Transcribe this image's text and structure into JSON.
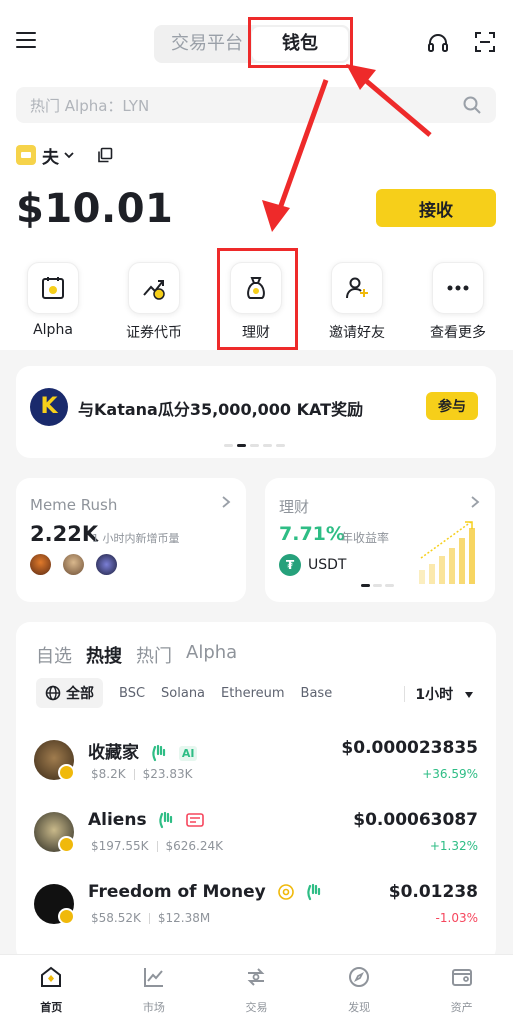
{
  "header": {
    "tabs": [
      "交易平台",
      "钱包"
    ],
    "active_tab": "钱包"
  },
  "search": {
    "placeholder": "热门 Alpha：LYN"
  },
  "account": {
    "name": "夫"
  },
  "balance": {
    "amount": "$10.01"
  },
  "receive_label": "接收",
  "quick_actions": [
    {
      "label": "Alpha",
      "icon": "alpha-icon"
    },
    {
      "label": "证券代币",
      "icon": "stock-token-icon"
    },
    {
      "label": "理财",
      "icon": "earn-bag-icon"
    },
    {
      "label": "邀请好友",
      "icon": "invite-friend-icon"
    },
    {
      "label": "查看更多",
      "icon": "more-icon"
    }
  ],
  "banner": {
    "logo_letter": "K",
    "text": "与Katana瓜分35,000,000 KAT奖励",
    "button": "参与"
  },
  "meme_card": {
    "title": "Meme Rush",
    "value": "2.22K",
    "sub": "1 小时内新增币量"
  },
  "earn_card": {
    "title": "理财",
    "rate": "7.71%",
    "sub": "年收益率",
    "asset": "USDT"
  },
  "list": {
    "tabs": [
      "自选",
      "热搜",
      "热门",
      "Alpha"
    ],
    "active_tab": "热搜",
    "chains": [
      "全部",
      "BSC",
      "Solana",
      "Ethereum",
      "Base"
    ],
    "time": "1小时",
    "rows": [
      {
        "name": "收藏家",
        "mcap": "$8.2K",
        "vol": "$23.83K",
        "price": "$0.000023835",
        "change": "+36.59%",
        "tag": "AI"
      },
      {
        "name": "Aliens",
        "mcap": "$197.55K",
        "vol": "$626.24K",
        "price": "$0.00063087",
        "change": "+1.32%"
      },
      {
        "name": "Freedom of Money",
        "mcap": "$58.52K",
        "vol": "$12.38M",
        "price": "$0.01238",
        "change": "-1.03%"
      }
    ]
  },
  "bottom_nav": [
    {
      "label": "首页",
      "icon": "home-icon"
    },
    {
      "label": "市场",
      "icon": "market-icon"
    },
    {
      "label": "交易",
      "icon": "trade-icon"
    },
    {
      "label": "发现",
      "icon": "discover-icon"
    },
    {
      "label": "资产",
      "icon": "assets-icon"
    }
  ],
  "colors": {
    "accent": "#f6cf1a",
    "up": "#2ebd85",
    "down": "#f6465d",
    "annotation": "#ee2a2a"
  }
}
